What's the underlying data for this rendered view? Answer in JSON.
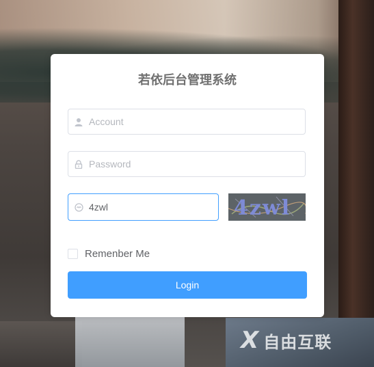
{
  "page": {
    "title": "若依后台管理系统"
  },
  "form": {
    "account_placeholder": "Account",
    "password_placeholder": "Password",
    "code_value": "4zwl",
    "captcha_text": "4zwl",
    "remember_label": "Remenber Me",
    "login_label": "Login"
  },
  "watermark": {
    "text": "自由互联",
    "mark": "X"
  },
  "colors": {
    "primary": "#409eff",
    "border": "#dcdfe6",
    "title": "#707070"
  },
  "icons": {
    "account": "user-icon",
    "password": "lock-icon",
    "code": "captcha-icon"
  }
}
